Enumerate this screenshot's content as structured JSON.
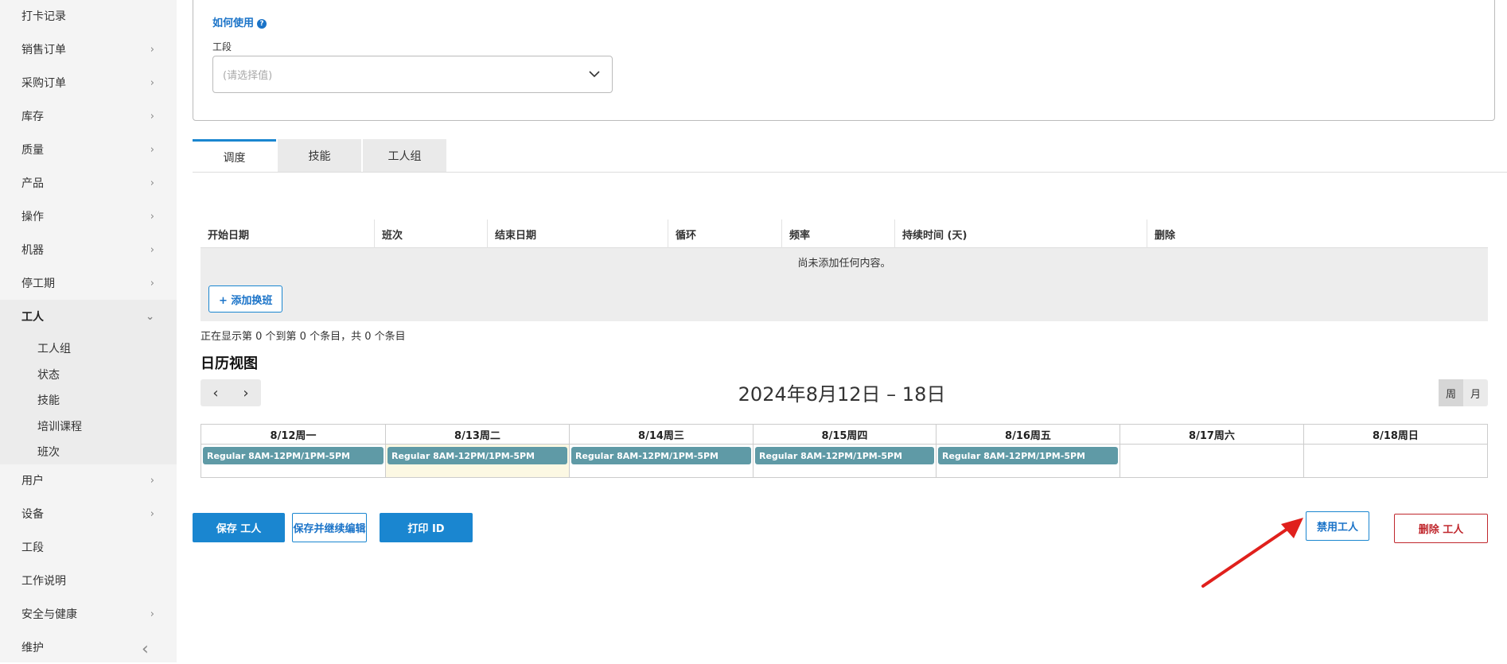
{
  "sidebar": {
    "items": [
      {
        "label": "打卡记录",
        "chevron": false
      },
      {
        "label": "销售订单",
        "chevron": true
      },
      {
        "label": "采购订单",
        "chevron": true
      },
      {
        "label": "库存",
        "chevron": true
      },
      {
        "label": "质量",
        "chevron": true
      },
      {
        "label": "产品",
        "chevron": true
      },
      {
        "label": "操作",
        "chevron": true
      },
      {
        "label": "机器",
        "chevron": true
      },
      {
        "label": "停工期",
        "chevron": true
      },
      {
        "label": "工人",
        "chevron": true,
        "expanded": true
      },
      {
        "label": "用户",
        "chevron": true
      },
      {
        "label": "设备",
        "chevron": true
      },
      {
        "label": "工段",
        "chevron": false
      },
      {
        "label": "工作说明",
        "chevron": false
      },
      {
        "label": "安全与健康",
        "chevron": true
      },
      {
        "label": "维护",
        "chevron": false
      }
    ],
    "sub_items": [
      "工人组",
      "状态",
      "技能",
      "培训课程",
      "班次"
    ],
    "chevron_right": "›",
    "chevron_down": "⌄",
    "collapse_glyph": "‹"
  },
  "form": {
    "help_link": "如何使用",
    "help_icon": "?",
    "section_label": "工段",
    "section_placeholder": "(请选择值)"
  },
  "tabs": [
    "调度",
    "技能",
    "工人组"
  ],
  "schedule_table": {
    "columns": [
      "开始日期",
      "班次",
      "结束日期",
      "循环",
      "频率",
      "持续时间 (天)",
      "删除"
    ],
    "empty_message": "尚未添加任何内容。",
    "add_button": "+ 添加换班",
    "showing_text": "正在显示第 0 个到第 0 个条目，共 0 个条目"
  },
  "calendar": {
    "title": "日历视图",
    "prev": "‹",
    "next": "›",
    "range": "2024年8月12日 – 18日",
    "views": [
      "周",
      "月"
    ],
    "active_view": "周",
    "days": [
      {
        "label": "8/12周一",
        "event": "Regular 8AM-12PM/1PM-5PM",
        "today": false
      },
      {
        "label": "8/13周二",
        "event": "Regular 8AM-12PM/1PM-5PM",
        "today": true
      },
      {
        "label": "8/14周三",
        "event": "Regular 8AM-12PM/1PM-5PM",
        "today": false
      },
      {
        "label": "8/15周四",
        "event": "Regular 8AM-12PM/1PM-5PM",
        "today": false
      },
      {
        "label": "8/16周五",
        "event": "Regular 8AM-12PM/1PM-5PM",
        "today": false
      },
      {
        "label": "8/17周六",
        "event": "",
        "today": false
      },
      {
        "label": "8/18周日",
        "event": "",
        "today": false
      }
    ]
  },
  "actions": {
    "save": "保存 工人",
    "save_continue": "保存并继续编辑",
    "print_id": "打印 ID",
    "disable": "禁用工人",
    "delete": "删除 工人"
  },
  "colors": {
    "primary": "#1a86d0",
    "event": "#5f9aa6",
    "danger": "#c0272d",
    "annotation_arrow": "#e0201c"
  }
}
